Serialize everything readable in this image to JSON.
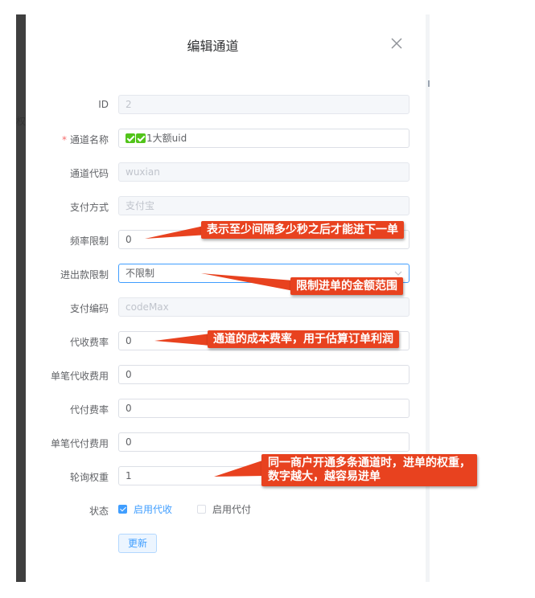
{
  "dialog": {
    "title": "编辑通道",
    "close_icon": "close-icon"
  },
  "fields": {
    "id": {
      "label": "ID",
      "value": "2"
    },
    "name": {
      "label": "通道名称",
      "required_mark": "*",
      "value": "1大额uid",
      "prefix_icons": [
        "check-mark-icon",
        "check-mark-icon"
      ]
    },
    "code": {
      "label": "通道代码",
      "value": "wuxian"
    },
    "pay_method": {
      "label": "支付方式",
      "value": "支付宝"
    },
    "frequency": {
      "label": "频率限制",
      "value": "0"
    },
    "in_out_limit": {
      "label": "进出款限制",
      "value": "不限制"
    },
    "pay_code": {
      "label": "支付编码",
      "value": "codeMax"
    },
    "collect_rate": {
      "label": "代收费率",
      "value": "0"
    },
    "collect_fee": {
      "label": "单笔代收费用",
      "value": "0"
    },
    "payout_rate": {
      "label": "代付费率",
      "value": "0"
    },
    "payout_fee": {
      "label": "单笔代付费用",
      "value": "0"
    },
    "weight": {
      "label": "轮询权重",
      "value": "1"
    }
  },
  "status": {
    "label": "状态",
    "collect": {
      "label": "启用代收",
      "checked": true
    },
    "payout": {
      "label": "启用代付",
      "checked": false
    }
  },
  "update_button": "更新",
  "annotations": {
    "frequency": "表示至少间隔多少秒之后才能进下一单",
    "amount": "限制进单的金额范围",
    "rate": "通道的成本费率，用于估算订单利润",
    "weight_line1": "同一商户开通多条通道时，进单的权重，",
    "weight_line2": "数字越大，越容易进单"
  },
  "colors": {
    "annotation_bg": "#e8421f",
    "accent": "#409eff",
    "required": "#f56c6c",
    "check_icon": "#52c41a"
  },
  "background": {
    "partial_text": "权"
  }
}
